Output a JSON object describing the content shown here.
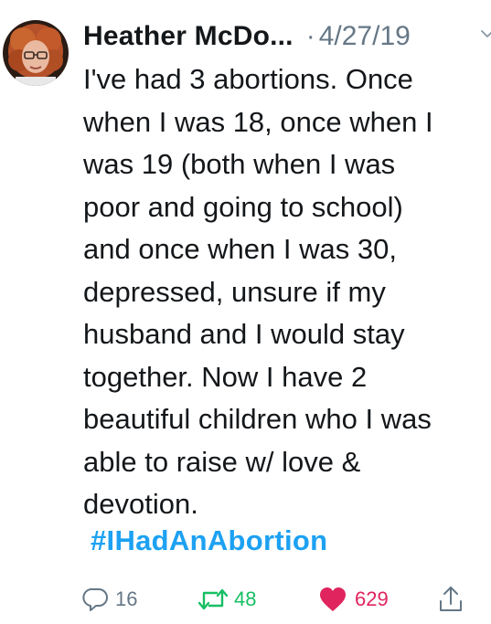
{
  "tweet": {
    "author_name": "Heather McDo...",
    "separator": "·",
    "date": "4/27/19",
    "text": "I've had 3 abortions. Once\nwhen I was 18, once when I\nwas 19 (both when I was\npoor and going to school)\nand once when I was 30,\ndepressed, unsure if my\nhusband and I would stay\ntogether. Now I have 2\nbeautiful children who I was\nable to raise w/ love &\ndevotion.",
    "hashtag": "#IHadAnAbortion"
  },
  "actions": {
    "reply": {
      "icon": "reply-icon",
      "count": "16"
    },
    "retweet": {
      "icon": "retweet-icon",
      "count": "48"
    },
    "like": {
      "icon": "heart-icon",
      "count": "629"
    },
    "share": {
      "icon": "share-icon"
    }
  },
  "colors": {
    "text": "#14171a",
    "muted": "#657786",
    "link": "#1da1f2",
    "retweet": "#17bf63",
    "like": "#e0245e"
  }
}
